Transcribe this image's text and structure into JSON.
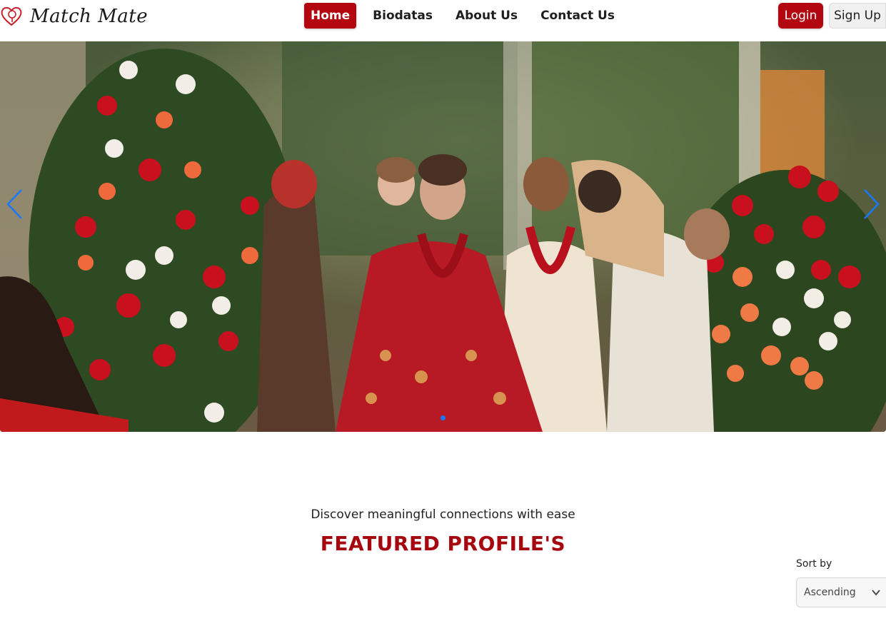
{
  "navbar": {
    "brand": "Match Mate",
    "links": [
      {
        "label": "Home",
        "active": true
      },
      {
        "label": "Biodatas",
        "active": false
      },
      {
        "label": "About Us",
        "active": false
      },
      {
        "label": "Contact Us",
        "active": false
      }
    ],
    "login_label": "Login",
    "signup_label": "Sign Up",
    "icons": {
      "brand": "heart-icon"
    }
  },
  "hero": {
    "image_label": "wedding-ceremony-photo",
    "prev_icon": "chevron-left-icon",
    "next_icon": "chevron-right-icon",
    "indicator_count": 1,
    "active_indicator": 0
  },
  "featured": {
    "tagline": "Discover meaningful connections with ease",
    "title": "FEATURED PROFILE'S"
  },
  "sort": {
    "label": "Sort by",
    "selected": "Ascending",
    "icon": "chevron-down-icon"
  },
  "colors": {
    "brand_red": "#b20610",
    "title_red": "#a6070f",
    "arrow_blue": "#1677ff"
  }
}
